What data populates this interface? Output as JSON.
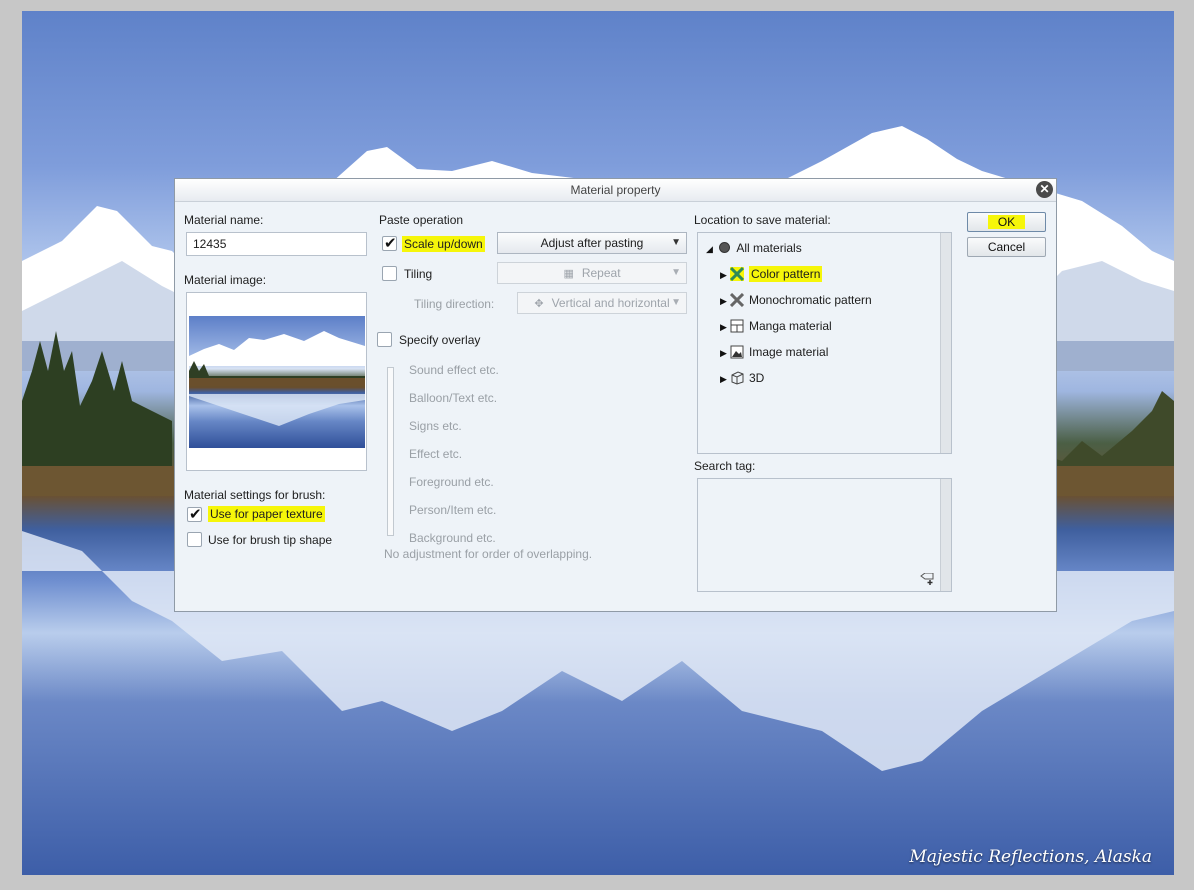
{
  "photo": {
    "caption": "Majestic Reflections, Alaska"
  },
  "dialog": {
    "title": "Material property",
    "close_icon": "close-icon",
    "left": {
      "material_name_label": "Material name:",
      "material_name_value": "12435",
      "material_image_label": "Material image:",
      "brush_settings_label": "Material settings for brush:",
      "use_paper_texture": {
        "label": "Use for paper texture",
        "checked": true
      },
      "use_brush_tip": {
        "label": "Use for brush tip shape",
        "checked": false
      }
    },
    "middle": {
      "paste_operation_label": "Paste operation",
      "scale_updown": {
        "label": "Scale up/down",
        "checked": true
      },
      "scale_dropdown": "Adjust after pasting",
      "tiling": {
        "label": "Tiling",
        "checked": false
      },
      "tiling_dropdown": "Repeat",
      "tiling_direction_label": "Tiling direction:",
      "tiling_direction_dropdown": "Vertical and horizontal",
      "specify_overlay": {
        "label": "Specify overlay",
        "checked": false
      },
      "overlay_levels": [
        "Sound effect etc.",
        "Balloon/Text etc.",
        "Signs etc.",
        "Effect etc.",
        "Foreground etc.",
        "Person/Item etc.",
        "Background etc."
      ],
      "overlay_note": "No adjustment for order of overlapping."
    },
    "right": {
      "location_label": "Location to save material:",
      "tree": {
        "root": "All materials",
        "children": [
          "Color pattern",
          "Monochromatic pattern",
          "Manga material",
          "Image material",
          "3D"
        ],
        "selected": "Color pattern"
      },
      "search_tag_label": "Search tag:"
    },
    "buttons": {
      "ok": "OK",
      "cancel": "Cancel"
    },
    "colors": {
      "highlight": "#f6f60a",
      "dialog_bg": "#eef3f8"
    }
  }
}
